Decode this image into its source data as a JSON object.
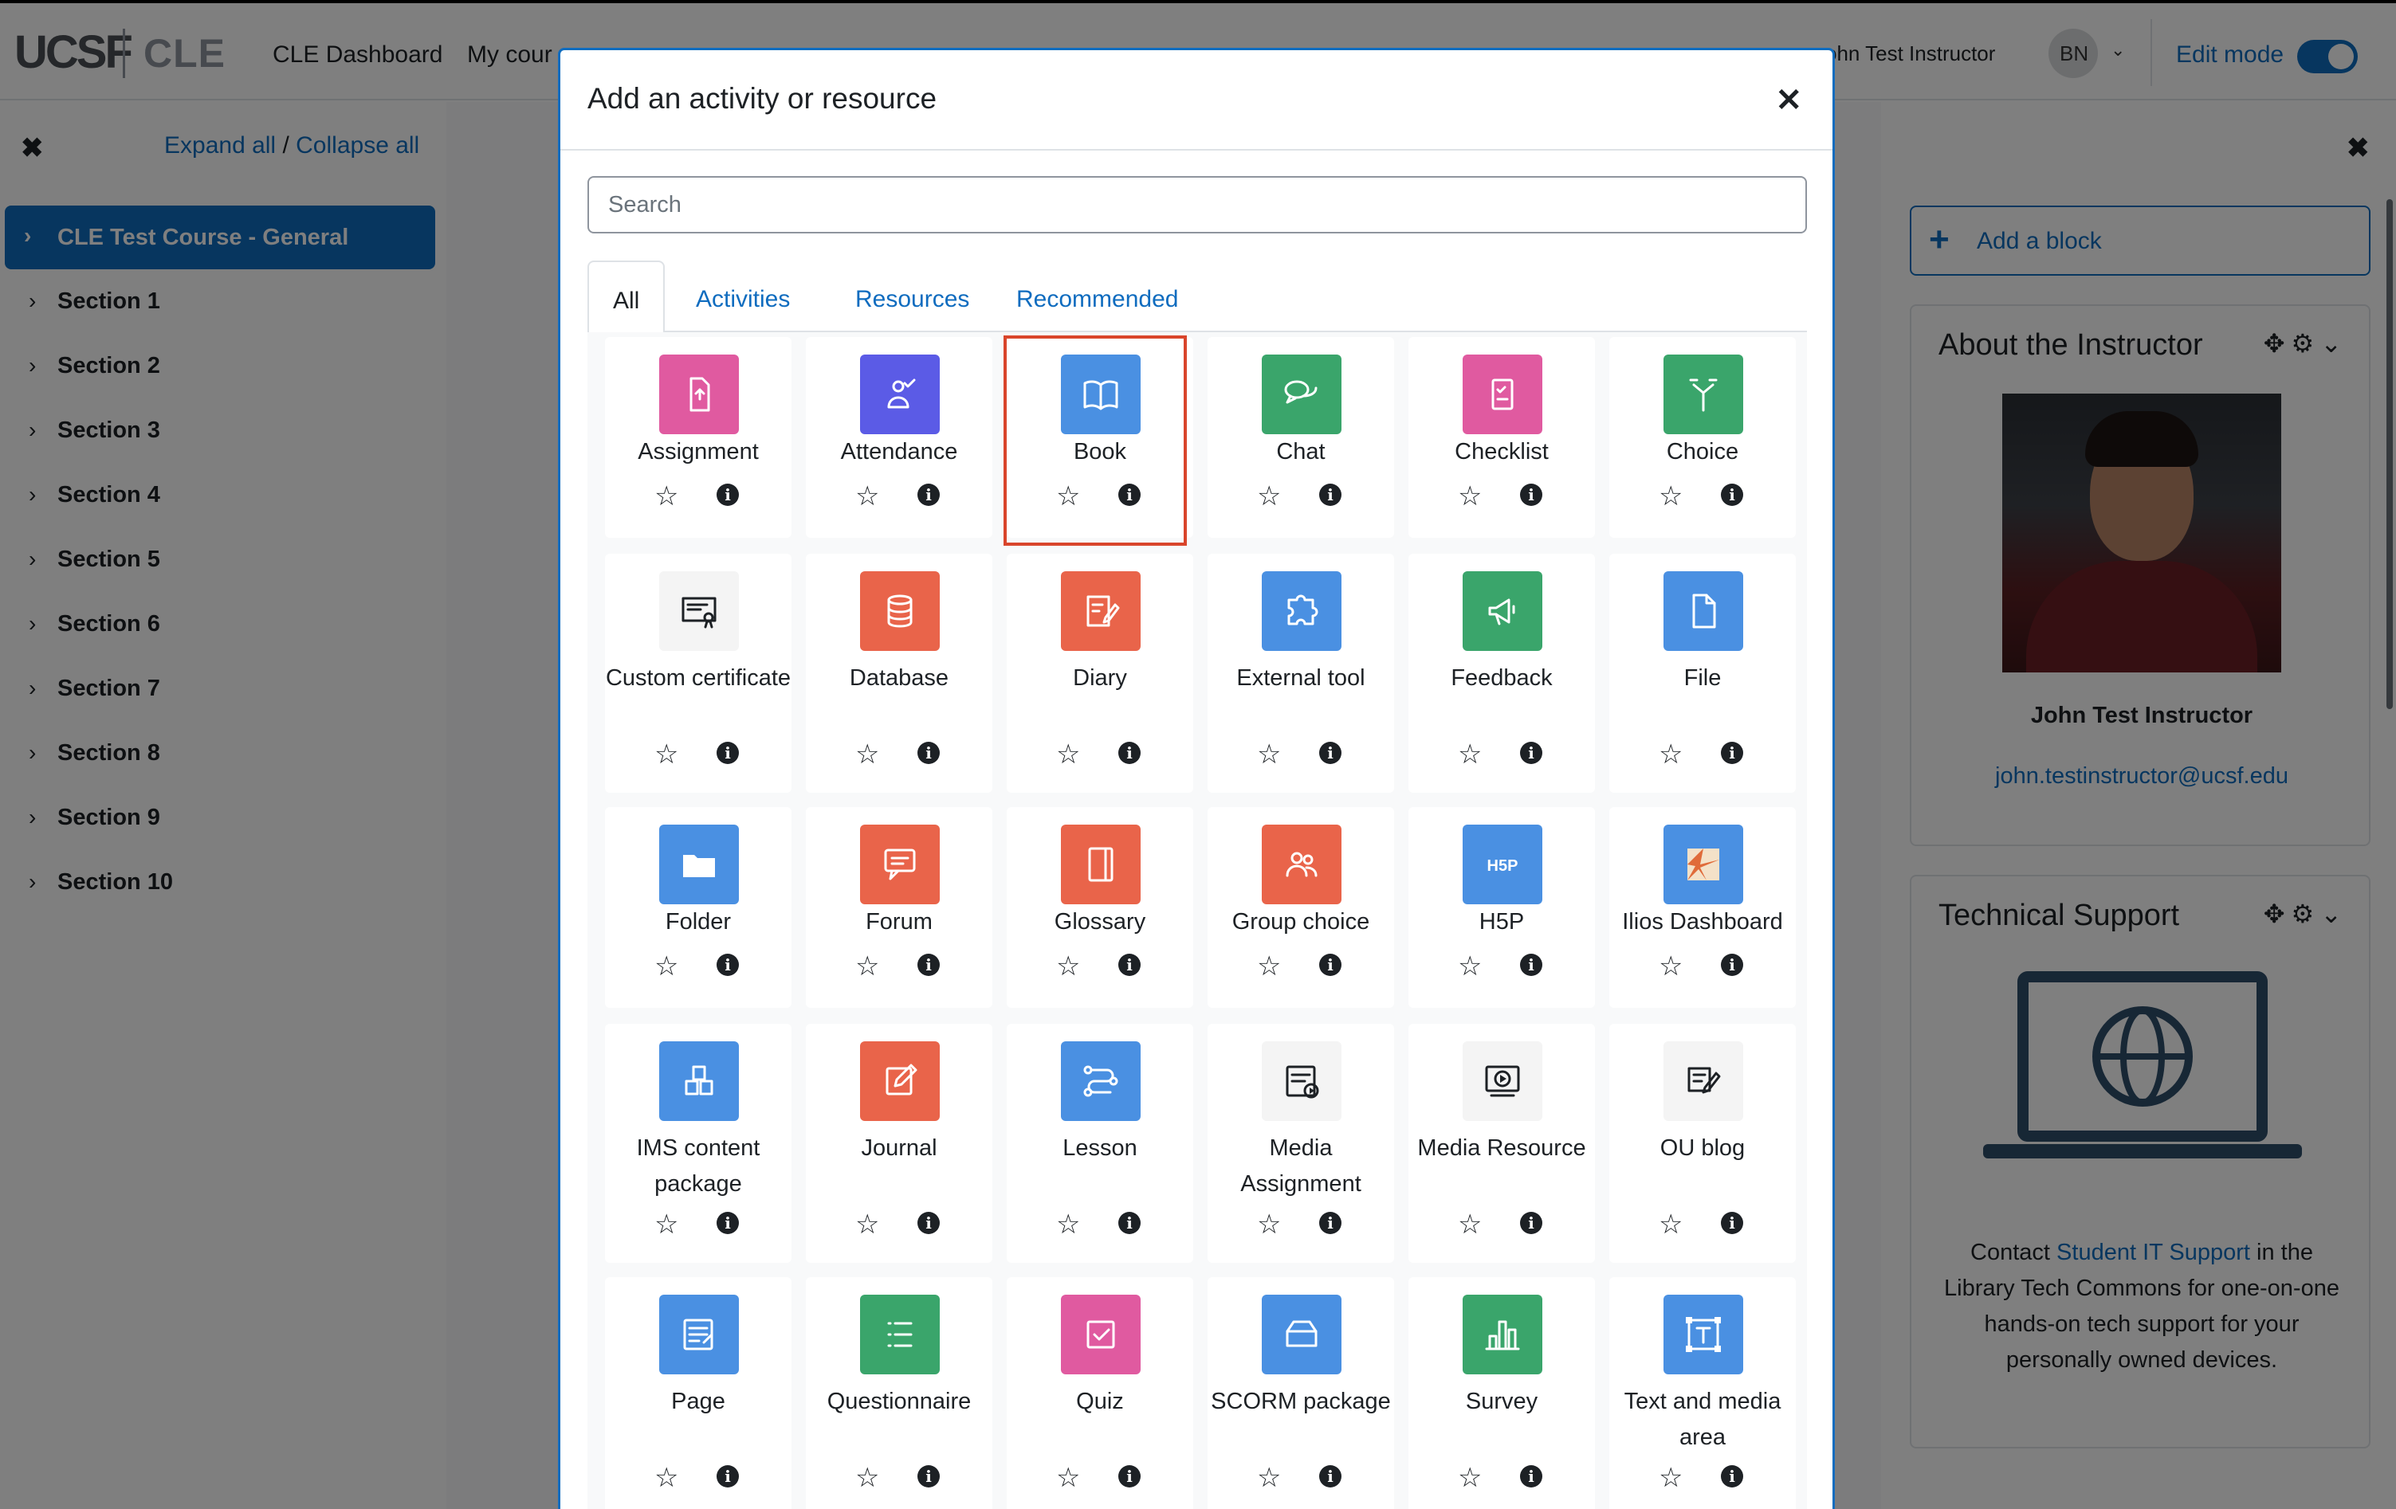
{
  "header": {
    "logo": "UCSF",
    "logo_sub": "CLE",
    "nav": [
      "CLE Dashboard",
      "My cour"
    ],
    "user_name": "ohn Test Instructor",
    "avatar_initials": "BN",
    "edit_mode_label": "Edit mode"
  },
  "course_index": {
    "expand_all": "Expand all",
    "separator": "/",
    "collapse_all": "Collapse all",
    "course": "CLE Test Course - General",
    "sections": [
      "Section 1",
      "Section 2",
      "Section 3",
      "Section 4",
      "Section 5",
      "Section 6",
      "Section 7",
      "Section 8",
      "Section 9",
      "Section 10"
    ]
  },
  "right_blocks": {
    "add_block": "Add a block",
    "about": {
      "title": "About the Instructor",
      "name": "John Test Instructor",
      "email": "john.testinstructor@ucsf.edu"
    },
    "support": {
      "title": "Technical Support",
      "text_before": "Contact ",
      "link": "Student IT Support",
      "text_after": " in the Library Tech Commons for one-on-one hands-on tech support for your personally owned devices."
    }
  },
  "modal": {
    "title": "Add an activity or resource",
    "search_placeholder": "Search",
    "tabs": [
      "All",
      "Activities",
      "Resources",
      "Recommended"
    ],
    "active_tab": "All",
    "highlighted": "Book",
    "items": [
      {
        "label": "Assignment",
        "icon": "assignment-icon",
        "color": "#e05aa0"
      },
      {
        "label": "Attendance",
        "icon": "attendance-icon",
        "color": "#5b5be6"
      },
      {
        "label": "Book",
        "icon": "book-icon",
        "color": "#4a90e2"
      },
      {
        "label": "Chat",
        "icon": "chat-icon",
        "color": "#3aa56b"
      },
      {
        "label": "Checklist",
        "icon": "checklist-icon",
        "color": "#e05aa0"
      },
      {
        "label": "Choice",
        "icon": "choice-icon",
        "color": "#3aa56b"
      },
      {
        "label": "Custom certificate",
        "icon": "certificate-icon",
        "color": "#f4f4f4"
      },
      {
        "label": "Database",
        "icon": "database-icon",
        "color": "#e9644a"
      },
      {
        "label": "Diary",
        "icon": "diary-icon",
        "color": "#e9644a"
      },
      {
        "label": "External tool",
        "icon": "puzzle-icon",
        "color": "#4a90e2"
      },
      {
        "label": "Feedback",
        "icon": "megaphone-icon",
        "color": "#3aa56b"
      },
      {
        "label": "File",
        "icon": "file-icon",
        "color": "#4a90e2"
      },
      {
        "label": "Folder",
        "icon": "folder-icon",
        "color": "#4a90e2"
      },
      {
        "label": "Forum",
        "icon": "forum-icon",
        "color": "#e9644a"
      },
      {
        "label": "Glossary",
        "icon": "glossary-icon",
        "color": "#e9644a"
      },
      {
        "label": "Group choice",
        "icon": "group-icon",
        "color": "#e9644a"
      },
      {
        "label": "H5P",
        "icon": "h5p-icon",
        "color": "#4a90e2"
      },
      {
        "label": "Ilios Dashboard",
        "icon": "ilios-icon",
        "color": "#4a90e2"
      },
      {
        "label": "IMS content package",
        "icon": "package-icon",
        "color": "#4a90e2"
      },
      {
        "label": "Journal",
        "icon": "journal-icon",
        "color": "#e9644a"
      },
      {
        "label": "Lesson",
        "icon": "lesson-icon",
        "color": "#4a90e2"
      },
      {
        "label": "Media Assignment",
        "icon": "media-assignment-icon",
        "color": "#f4f4f4"
      },
      {
        "label": "Media Resource",
        "icon": "media-resource-icon",
        "color": "#f4f4f4"
      },
      {
        "label": "OU blog",
        "icon": "blog-icon",
        "color": "#f4f4f4"
      },
      {
        "label": "Page",
        "icon": "page-icon",
        "color": "#4a90e2"
      },
      {
        "label": "Questionnaire",
        "icon": "questionnaire-icon",
        "color": "#3aa56b"
      },
      {
        "label": "Quiz",
        "icon": "quiz-icon",
        "color": "#e05aa0"
      },
      {
        "label": "SCORM package",
        "icon": "scorm-icon",
        "color": "#4a90e2"
      },
      {
        "label": "Survey",
        "icon": "survey-icon",
        "color": "#3aa56b"
      },
      {
        "label": "Text and media area",
        "icon": "text-media-icon",
        "color": "#4a90e2"
      }
    ],
    "star_glyph": "☆",
    "info_glyph": "i"
  }
}
